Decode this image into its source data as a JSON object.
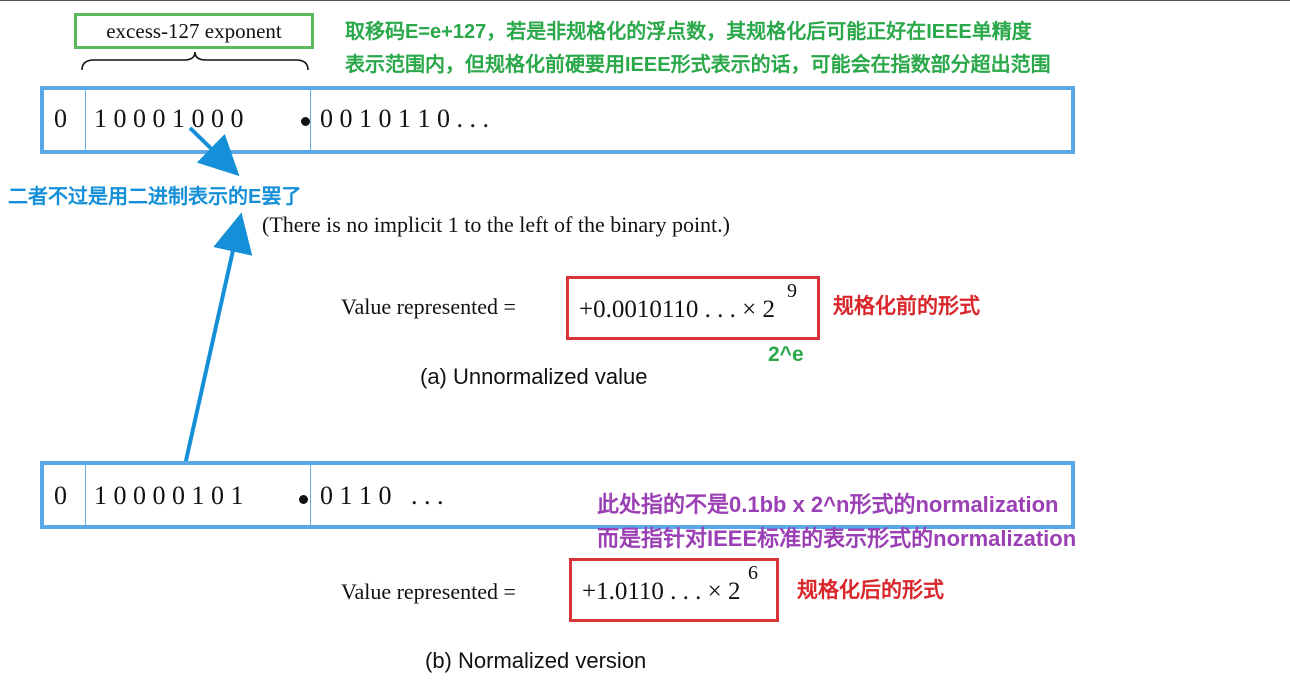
{
  "top_label": "excess-127 exponent",
  "annotations": {
    "green_line1": "取移码E=e+127，若是非规格化的浮点数，其规格化后可能正好在IEEE单精度",
    "green_line2": "表示范围内，但规格化前硬要用IEEE形式表示的话，可能会在指数部分超出范围",
    "blue_note": "二者不过是用二进制表示的E罢了",
    "pow_note": "2^e",
    "red_before": "规格化前的形式",
    "red_after": "规格化后的形式",
    "purple_line1": "此处指的不是0.1bb x 2^n形式的normalization",
    "purple_line2": "而是指针对IEEE标准的表示形式的normalization"
  },
  "register_a": {
    "sign": "0",
    "exponent": "1 0 0 0 1 0 0 0",
    "fraction": "0 0 1 0 1 1 0 . . ."
  },
  "register_b": {
    "sign": "0",
    "exponent": "1 0 0 0 0 1 0 1",
    "fraction": "0 1 1 0   . . ."
  },
  "implicit_note": "(There is no implicit 1 to the left of the binary point.)",
  "value_a": {
    "prefix": "Value represented  =",
    "mantissa": "+0.0010110 . . . × 2",
    "exp": "9"
  },
  "value_b": {
    "prefix": "Value represented  =",
    "mantissa": "+1.0110 . . . × 2",
    "exp": "6"
  },
  "caption_a": "(a) Unnormalized value",
  "caption_b": "(b) Normalized version",
  "colors": {
    "register_border": "#5aa9e6",
    "green": "#2aa84a",
    "blue": "#1590d8",
    "purple": "#9b3fb5",
    "red": "#d8262a"
  }
}
